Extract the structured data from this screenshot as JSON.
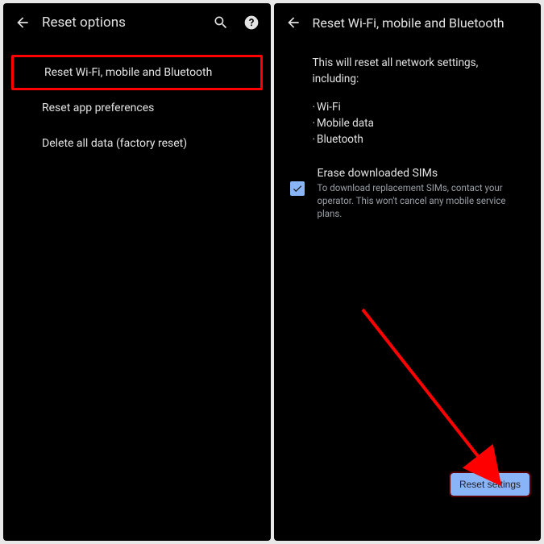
{
  "left": {
    "title": "Reset options",
    "items": [
      "Reset Wi-Fi, mobile and Bluetooth",
      "Reset app preferences",
      "Delete all data (factory reset)"
    ]
  },
  "right": {
    "title": "Reset Wi-Fi, mobile and Bluetooth",
    "intro": "This will reset all network settings, including:",
    "bullets": [
      "Wi-Fi",
      "Mobile data",
      "Bluetooth"
    ],
    "checkbox": {
      "title": "Erase downloaded SIMs",
      "desc": "To download replacement SIMs, contact your operator. This won't cancel any mobile service plans."
    },
    "button": "Reset settings"
  }
}
